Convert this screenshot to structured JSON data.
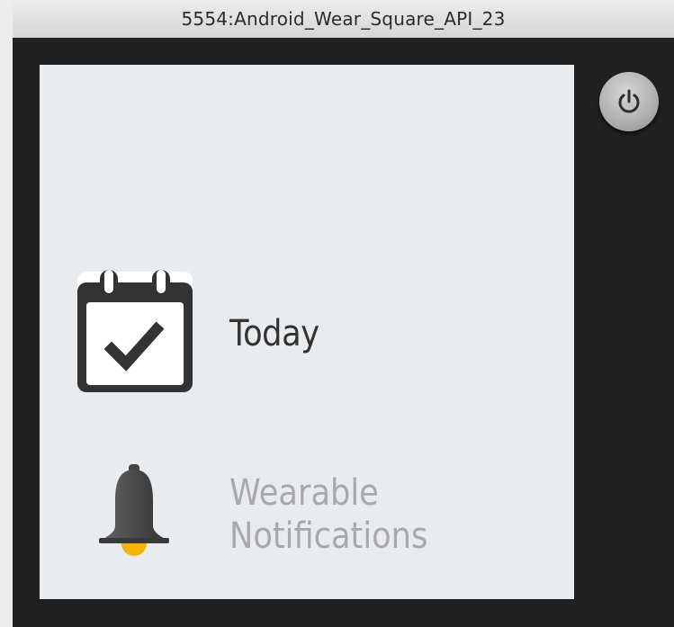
{
  "window": {
    "title": "5554:Android_Wear_Square_API_23"
  },
  "device": {
    "power_button_icon": "power-icon"
  },
  "menu": {
    "items": [
      {
        "label": "Today",
        "icon": "calendar-check-icon",
        "selected": true
      },
      {
        "label_line1": "Wearable",
        "label_line2": "Notifications",
        "icon": "bell-icon",
        "selected": false
      }
    ]
  },
  "colors": {
    "bezel": "#212121",
    "screen": "#e9ecef",
    "selected_text": "#333333",
    "unselected_text": "#a7a9ab",
    "bell_clapper": "#f4b400"
  }
}
